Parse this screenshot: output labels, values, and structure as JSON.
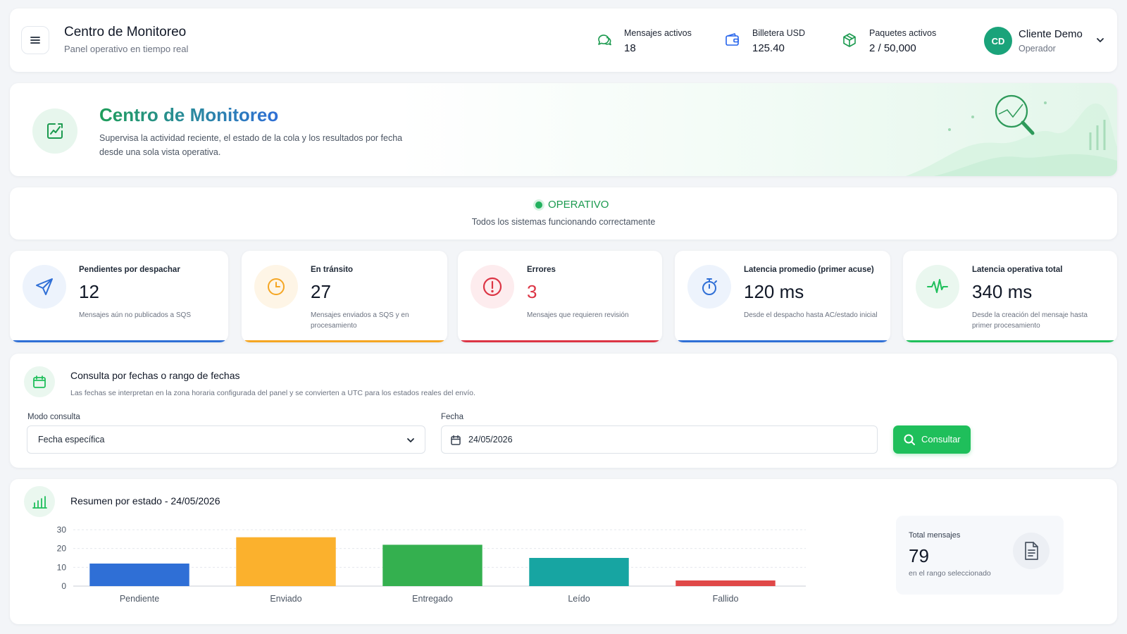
{
  "header": {
    "title": "Centro de Monitoreo",
    "subtitle": "Panel operativo en tiempo real",
    "chips": [
      {
        "label": "Mensajes activos",
        "value": "18",
        "icon": "chat-icon",
        "bg": "#eef8f1",
        "accent": "#1b9a4f"
      },
      {
        "label": "Billetera USD",
        "value": "125.40",
        "icon": "wallet-icon",
        "bg": "#eef4fd",
        "accent": "#2563eb"
      },
      {
        "label": "Paquetes activos",
        "value": "2 / 50,000",
        "icon": "package-icon",
        "bg": "#eef8f1",
        "accent": "#1b9a4f"
      }
    ],
    "user": {
      "initials": "CD",
      "name": "Cliente Demo",
      "role": "Operador"
    }
  },
  "hero": {
    "title": "Centro de Monitoreo",
    "description": "Supervisa la actividad reciente, el estado de la cola y los resultados por fecha desde una sola vista operativa."
  },
  "status": {
    "label": "OPERATIVO",
    "message": "Todos los sistemas funcionando correctamente",
    "color": "#22b15e"
  },
  "kpis": [
    {
      "label": "Pendientes por despachar",
      "value": "12",
      "desc": "Mensajes aún no publicados a SQS",
      "icon": "send-icon",
      "color": "#2f6fd6",
      "bg": "#edf3fc"
    },
    {
      "label": "En tránsito",
      "value": "27",
      "desc": "Mensajes enviados a SQS y en procesamiento",
      "icon": "clock-icon",
      "color": "#f5a623",
      "bg": "#fef5e6"
    },
    {
      "label": "Errores",
      "value": "3",
      "desc": "Mensajes que requieren revisión",
      "icon": "alert-icon",
      "color": "#dc3545",
      "bg": "#fdecee"
    },
    {
      "label": "Latencia promedio (primer acuse)",
      "value": "120 ms",
      "desc": "Desde el despacho hasta AC/estado inicial",
      "icon": "stopwatch-icon",
      "color": "#2f6fd6",
      "bg": "#edf3fc"
    },
    {
      "label": "Latencia operativa total",
      "value": "340 ms",
      "desc": "Desde la creación del mensaje hasta primer procesamiento",
      "icon": "pulse-icon",
      "color": "#1fbf5b",
      "bg": "#eaf7ef"
    }
  ],
  "query": {
    "title": "Consulta por fechas o rango de fechas",
    "subtitle": "Las fechas se interpretan en la zona horaria configurada del panel y se convierten a UTC para los estados reales del envío.",
    "mode_label": "Modo consulta",
    "mode_value": "Fecha específica",
    "date_label": "Fecha",
    "date_value": "24/05/2026",
    "button_label": "Consultar"
  },
  "summary": {
    "title": "Resumen por estado - 24/05/2026",
    "total_label": "Total mensajes",
    "total_value": "79",
    "total_sub": "en el rango seleccionado"
  },
  "chart_data": {
    "type": "bar",
    "categories": [
      "Pendiente",
      "Enviado",
      "Entregado",
      "Leído",
      "Fallido"
    ],
    "values": [
      12,
      26,
      22,
      15,
      3
    ],
    "colors": [
      "#2f6fd6",
      "#fbb12d",
      "#34b04f",
      "#17a5a2",
      "#e04848"
    ],
    "yticks": [
      0,
      10,
      20,
      30
    ],
    "ylim": [
      0,
      30
    ],
    "grid": true,
    "title": "",
    "xlabel": "",
    "ylabel": ""
  }
}
